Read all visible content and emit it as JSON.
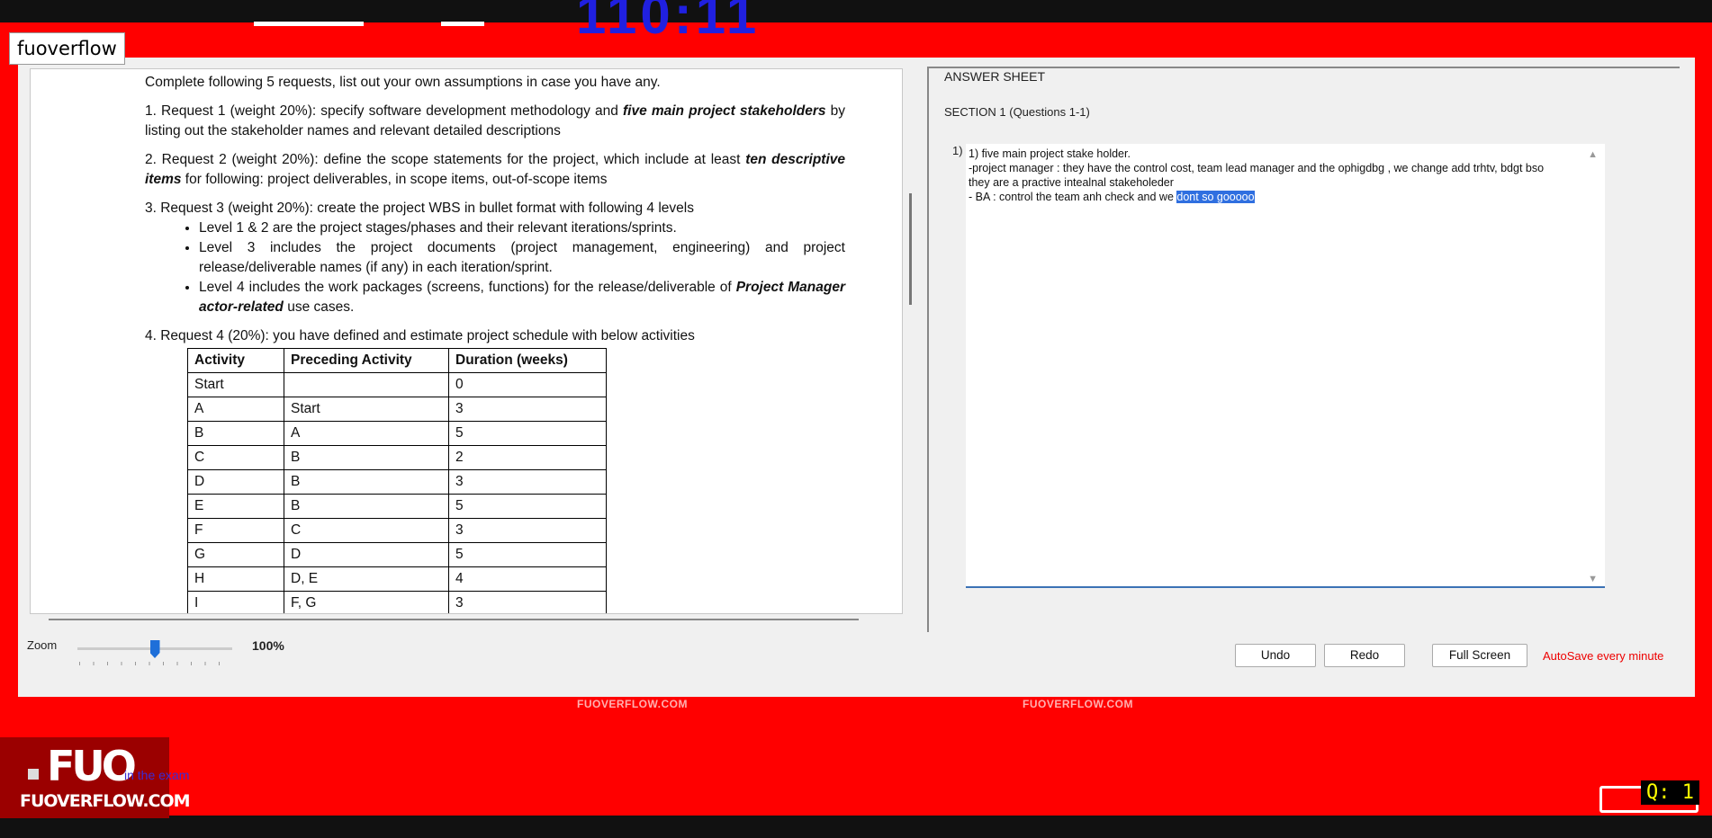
{
  "overlay": {
    "timer": "110:11",
    "tag_label": "fuoverflow",
    "watermark_site": "FUOVERFLOW.COM",
    "logo_big": "FUO",
    "logo_small": "FUOVERFLOW.COM",
    "logo_tail": "in the exam",
    "q_badge": "Q: 1"
  },
  "question": {
    "intro": "Complete following 5 requests, list out your own assumptions in case you have any.",
    "r1_a": "1. Request 1 (weight 20%): specify software development methodology and ",
    "r1_b": "five main project stakeholders",
    "r1_c": " by listing out the stakeholder names and relevant detailed descriptions",
    "r2_a": "2. Request 2 (weight 20%): define the scope statements for the project, which include at least ",
    "r2_b": "ten descriptive items",
    "r2_c": " for following: project deliverables, in scope items, out-of-scope items",
    "r3": "3. Request 3 (weight 20%): create the project WBS in bullet format with following 4 levels",
    "r3_b1": "Level 1 & 2 are the project stages/phases and their relevant iterations/sprints.",
    "r3_b2": "Level 3 includes the project documents (project management, engineering) and project release/deliverable names (if any) in each iteration/sprint.",
    "r3_b3_a": "Level 4 includes the work packages (screens, functions) for the release/deliverable of ",
    "r3_b3_b": "Project Manager actor-related",
    "r3_b3_c": " use cases.",
    "r4": "4. Request 4 (20%): you have defined and estimate project schedule with below activities",
    "table_headers": [
      "Activity",
      "Preceding Activity",
      "Duration (weeks)"
    ],
    "table_rows": [
      [
        "Start",
        "",
        "0"
      ],
      [
        "A",
        "Start",
        "3"
      ],
      [
        "B",
        "A",
        "5"
      ],
      [
        "C",
        "B",
        "2"
      ],
      [
        "D",
        "B",
        "3"
      ],
      [
        "E",
        "B",
        "5"
      ],
      [
        "F",
        "C",
        "3"
      ],
      [
        "G",
        "D",
        "5"
      ],
      [
        "H",
        "D, E",
        "4"
      ],
      [
        "I",
        "F, G",
        "3"
      ]
    ]
  },
  "answer": {
    "header": "ANSWER SHEET",
    "section": "SECTION 1 (Questions 1-1)",
    "qnum": "1)",
    "text_main": "1) five main project stake holder.\n-project manager : they have the control cost, team lead manager and the ophigdbg , we change add trhtv, bdgt bso\nthey are a practive intealnal stakeholeder\n- BA : control the team anh check and we ",
    "text_selected": "dont so gooooo"
  },
  "controls": {
    "zoom_label": "Zoom",
    "zoom_value": "100%",
    "zoom_level": 0.5,
    "undo": "Undo",
    "redo": "Redo",
    "full_screen": "Full Screen",
    "autosave": "AutoSave every minute"
  }
}
